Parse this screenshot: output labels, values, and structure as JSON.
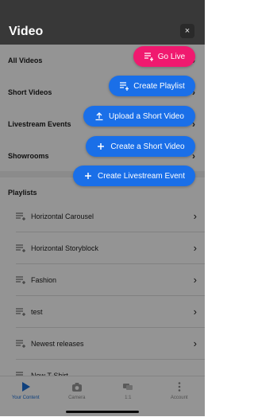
{
  "header": {
    "title": "Video",
    "close_label": "×"
  },
  "menu": {
    "items": [
      {
        "label": "All Videos"
      },
      {
        "label": "Short Videos"
      },
      {
        "label": "Livestream Events"
      },
      {
        "label": "Showrooms"
      }
    ]
  },
  "playlists": {
    "title": "Playlists",
    "items": [
      {
        "label": "Horizontal Carousel"
      },
      {
        "label": "Horizontal Storyblock"
      },
      {
        "label": "Fashion"
      },
      {
        "label": "test"
      },
      {
        "label": "Newest releases"
      },
      {
        "label": "New T-Shirt"
      }
    ]
  },
  "actions": {
    "go_live": {
      "label": "Go Live",
      "icon": "playlist-icon",
      "color": "#f0196f"
    },
    "create_playlist": {
      "label": "Create Playlist",
      "icon": "playlist-icon",
      "color": "#1a6fe8"
    },
    "upload_short_video": {
      "label": "Upload a Short Video",
      "icon": "upload-icon",
      "color": "#1a6fe8"
    },
    "create_short_video": {
      "label": "Create a Short Video",
      "icon": "plus-icon",
      "color": "#1a6fe8"
    },
    "create_livestream_event": {
      "label": "Create Livestream Event",
      "icon": "plus-icon",
      "color": "#1a6fe8"
    }
  },
  "tabbar": {
    "tabs": [
      {
        "label": "Your Content",
        "icon": "play-icon",
        "active": true
      },
      {
        "label": "Camera",
        "icon": "camera-icon",
        "active": false
      },
      {
        "label": "1:1",
        "icon": "chat-icon",
        "active": false
      },
      {
        "label": "Account",
        "icon": "more-vertical-icon",
        "active": false
      }
    ],
    "active_color": "#1a6fd8"
  }
}
